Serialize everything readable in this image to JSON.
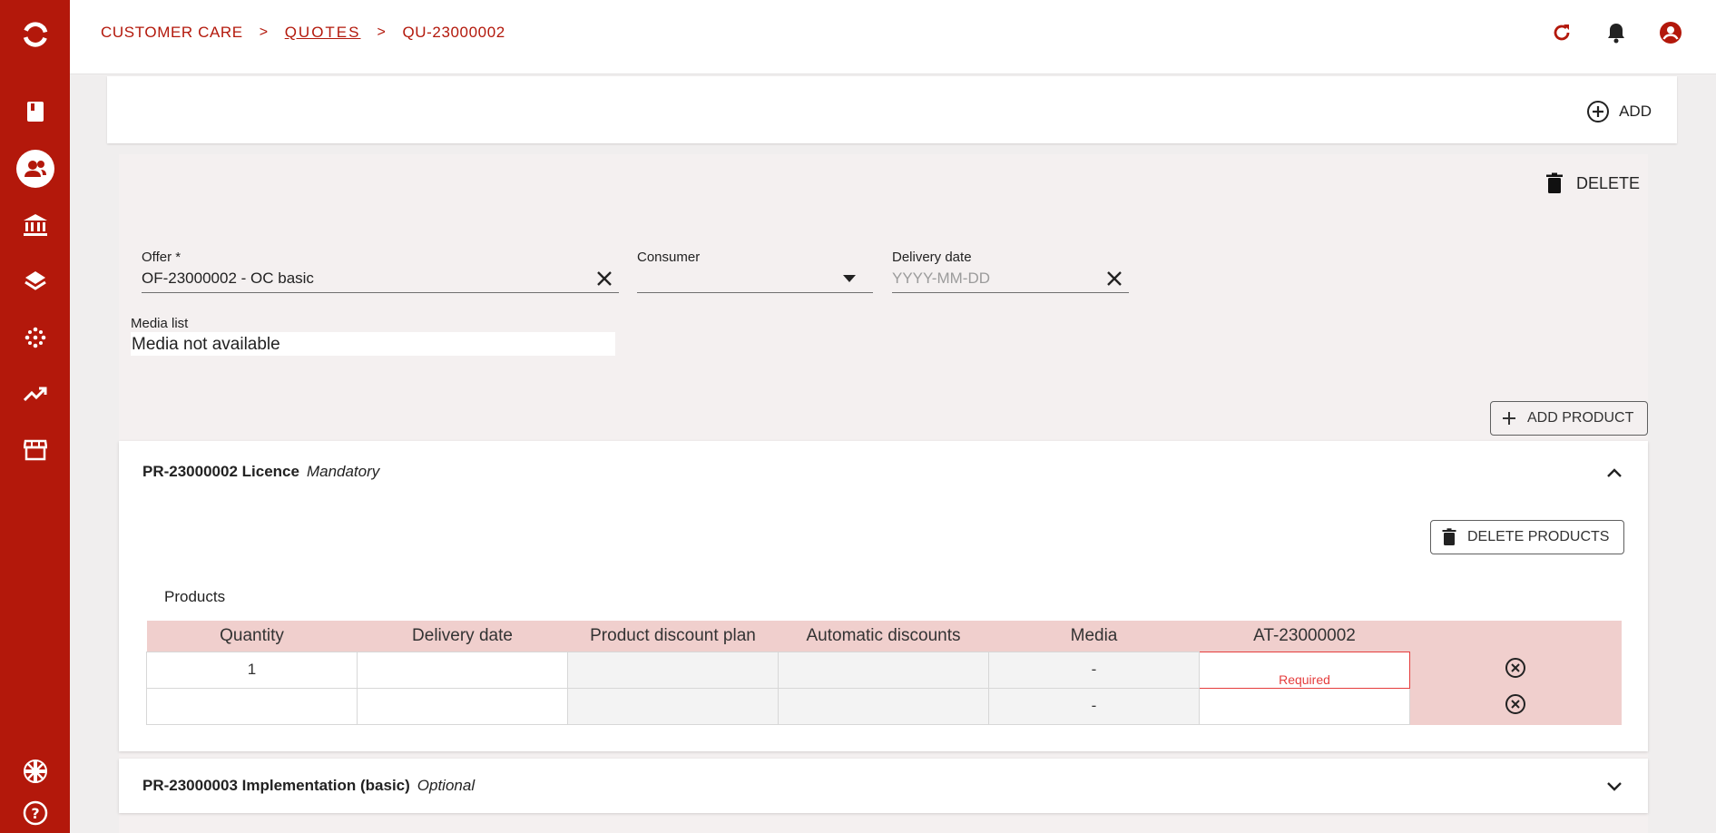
{
  "breadcrumb": {
    "items": [
      "CUSTOMER CARE",
      "QUOTES",
      "QU-23000002"
    ],
    "separator": ">"
  },
  "topbar": {
    "icons": [
      "refresh-icon",
      "bell-icon",
      "account-icon"
    ]
  },
  "sidebar": {
    "logo": "logo-icon",
    "items": [
      "book-icon",
      "customers-icon",
      "bank-icon",
      "layers-icon",
      "network-icon",
      "trending-up-icon",
      "store-icon"
    ],
    "bottom": [
      "uk-flag-icon",
      "help-icon"
    ]
  },
  "actions": {
    "add_label": "ADD",
    "delete_label": "DELETE",
    "add_product_label": "ADD PRODUCT",
    "delete_products_label": "DELETE PRODUCTS"
  },
  "form": {
    "offer": {
      "label": "Offer *",
      "value": "OF-23000002 - OC basic"
    },
    "consumer": {
      "label": "Consumer",
      "value": ""
    },
    "delivery_date": {
      "label": "Delivery date",
      "placeholder": "YYYY-MM-DD"
    },
    "media_list": {
      "label": "Media list",
      "value": "Media not available"
    }
  },
  "products": [
    {
      "code": "PR-23000002 Licence",
      "tag": "Mandatory",
      "expanded": true,
      "table_title": "Products",
      "columns": [
        "Quantity",
        "Delivery date",
        "Product discount plan",
        "Automatic discounts",
        "Media",
        "AT-23000002",
        ""
      ],
      "rows": [
        {
          "quantity": "1",
          "delivery_date": "",
          "discount_plan": "",
          "automatic_discounts": "",
          "media": "-",
          "at": "Required"
        },
        {
          "quantity": "",
          "delivery_date": "",
          "discount_plan": "",
          "automatic_discounts": "",
          "media": "-",
          "at": ""
        }
      ]
    },
    {
      "code": "PR-23000003 Implementation (basic)",
      "tag": "Optional",
      "expanded": false
    }
  ],
  "colors": {
    "brand": "#b3180b",
    "header_pink": "#f0cfcd",
    "error": "#e53d3d"
  }
}
